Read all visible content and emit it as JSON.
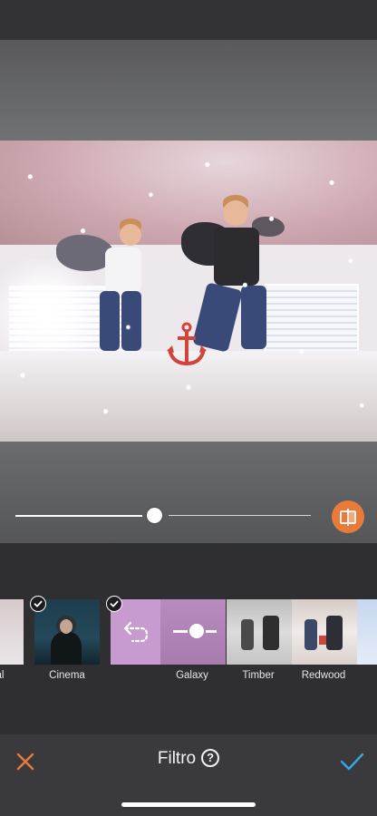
{
  "editor": {
    "intensity_percent": 47
  },
  "filters": {
    "items": [
      {
        "label": "al",
        "selected": false
      },
      {
        "label": "Cinema",
        "selected": true
      },
      {
        "label": "",
        "selected": true,
        "icon": "undo-icon"
      },
      {
        "label": "Galaxy",
        "selected": false
      },
      {
        "label": "Timber",
        "selected": false
      },
      {
        "label": "Redwood",
        "selected": false
      },
      {
        "label": "",
        "selected": false
      }
    ]
  },
  "bottom_bar": {
    "title": "Filtro",
    "help_label": "?"
  },
  "icons": {
    "close": "close-icon",
    "confirm": "checkmark-icon",
    "compare": "compare-icon",
    "help": "help-icon",
    "undo": "undo-icon",
    "selected": "checkmark-badge-icon"
  },
  "colors": {
    "accent_orange": "#e87a3a",
    "confirm_blue": "#35a7e0"
  }
}
